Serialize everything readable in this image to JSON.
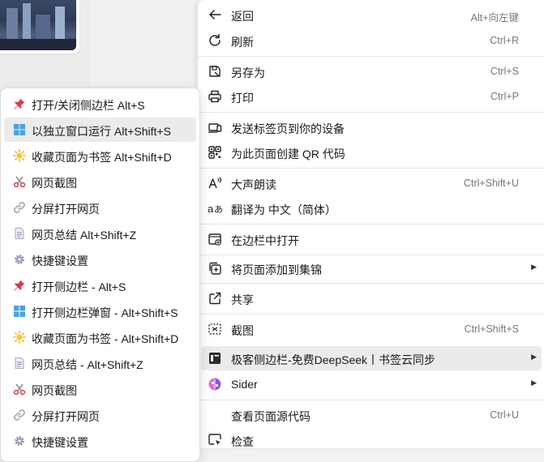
{
  "colors": {
    "menu_bg": "#ffffff",
    "highlight_bg": "#ebebeb",
    "shortcut_text": "#777777",
    "separator": "#e6e6e6"
  },
  "main_menu": {
    "items": [
      {
        "label": "返回",
        "shortcut": "Alt+向左键",
        "icon": "back-arrow-icon"
      },
      {
        "label": "刷新",
        "shortcut": "Ctrl+R",
        "icon": "refresh-icon"
      },
      {
        "label": "另存为",
        "shortcut": "Ctrl+S",
        "icon": "save-as-icon"
      },
      {
        "label": "打印",
        "shortcut": "Ctrl+P",
        "icon": "print-icon"
      },
      {
        "label": "发送标签页到你的设备",
        "shortcut": "",
        "icon": "send-to-devices-icon"
      },
      {
        "label": "为此页面创建 QR 代码",
        "shortcut": "",
        "icon": "qr-code-icon"
      },
      {
        "label": "大声朗读",
        "shortcut": "Ctrl+Shift+U",
        "icon": "read-aloud-icon"
      },
      {
        "label": "翻译为 中文（简体）",
        "shortcut": "",
        "icon": "translate-icon"
      },
      {
        "label": "在边栏中打开",
        "shortcut": "",
        "icon": "open-in-sidebar-icon"
      },
      {
        "label": "将页面添加到集锦",
        "shortcut": "",
        "icon": "collections-icon"
      },
      {
        "label": "共享",
        "shortcut": "",
        "icon": "share-icon"
      },
      {
        "label": "截图",
        "shortcut": "Ctrl+Shift+S",
        "icon": "screenshot-icon"
      },
      {
        "label": "极客侧边栏-免费DeepSeek丨书签云同步",
        "shortcut": "",
        "icon": "geek-sidebar-extension-icon"
      },
      {
        "label": "Sider",
        "shortcut": "",
        "icon": "sider-extension-icon"
      },
      {
        "label": "查看页面源代码",
        "shortcut": "Ctrl+U",
        "icon": ""
      },
      {
        "label": "检查",
        "shortcut": "",
        "icon": "inspect-icon"
      }
    ]
  },
  "sub_menu": {
    "items": [
      {
        "label": "打开/关闭侧边栏 Alt+S",
        "icon": "pin-icon"
      },
      {
        "label": "以独立窗口运行 Alt+Shift+S",
        "icon": "window-grid-icon"
      },
      {
        "label": "收藏页面为书签 Alt+Shift+D",
        "icon": "sun-star-icon"
      },
      {
        "label": "网页截图",
        "icon": "scissors-icon"
      },
      {
        "label": "分屏打开网页",
        "icon": "link-icon"
      },
      {
        "label": "网页总结 Alt+Shift+Z",
        "icon": "document-icon"
      },
      {
        "label": "快捷键设置",
        "icon": "gear-icon"
      },
      {
        "label": "打开侧边栏 - Alt+S",
        "icon": "pin-icon"
      },
      {
        "label": "打开侧边栏弹窗 - Alt+Shift+S",
        "icon": "window-grid-icon"
      },
      {
        "label": "收藏页面为书签 - Alt+Shift+D",
        "icon": "sun-star-icon"
      },
      {
        "label": "网页总结 - Alt+Shift+Z",
        "icon": "document-icon"
      },
      {
        "label": "网页截图",
        "icon": "scissors-icon"
      },
      {
        "label": "分屏打开网页",
        "icon": "link-icon"
      },
      {
        "label": "快捷键设置",
        "icon": "gear-icon"
      }
    ]
  }
}
